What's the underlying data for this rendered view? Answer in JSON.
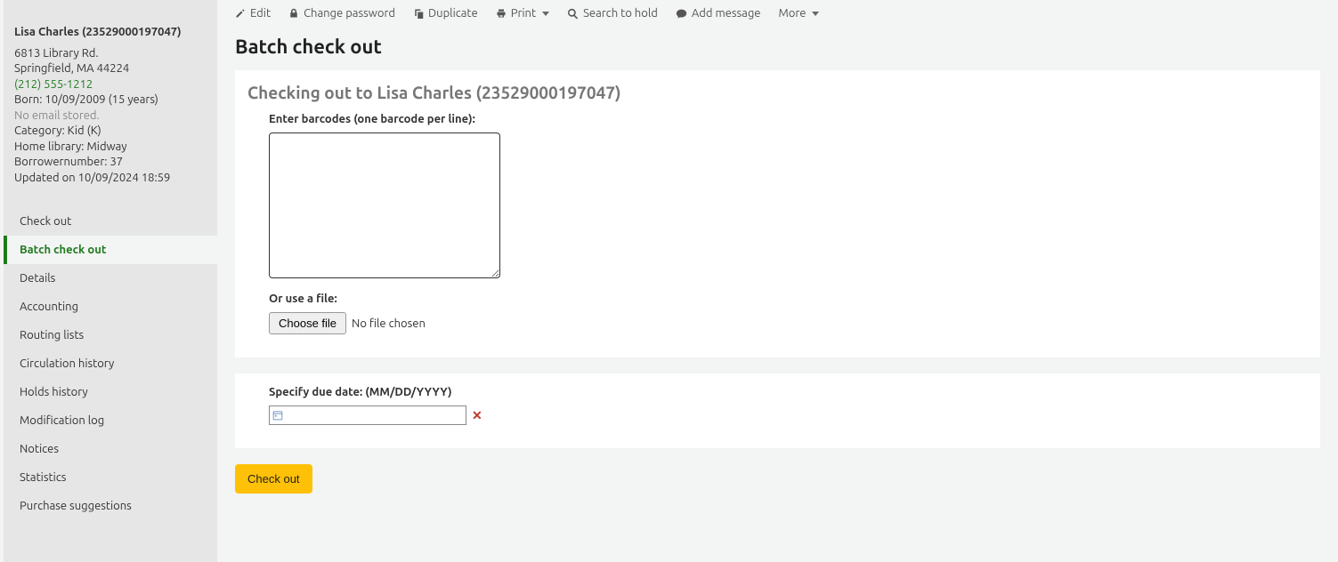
{
  "patron": {
    "name": "Lisa Charles (23529000197047)",
    "address1": "6813 Library Rd.",
    "address2": "Springfield, MA 44224",
    "phone": "(212) 555-1212",
    "born": "Born: 10/09/2009 (15 years)",
    "email": "No email stored.",
    "category": "Category: Kid (K)",
    "homeLibrary": "Home library: Midway",
    "borrowerNumber": "Borrowernumber: 37",
    "updated": "Updated on 10/09/2024 18:59"
  },
  "nav": {
    "checkout": "Check out",
    "batch": "Batch check out",
    "details": "Details",
    "accounting": "Accounting",
    "routing": "Routing lists",
    "circ": "Circulation history",
    "holds": "Holds history",
    "modlog": "Modification log",
    "notices": "Notices",
    "stats": "Statistics",
    "purchase": "Purchase suggestions"
  },
  "toolbar": {
    "edit": "Edit",
    "changePassword": "Change password",
    "duplicate": "Duplicate",
    "print": "Print",
    "searchToHold": "Search to hold",
    "addMessage": "Add message",
    "more": "More"
  },
  "page": {
    "title": "Batch check out",
    "checkingOutTo": "Checking out to Lisa Charles (23529000197047)",
    "barcodesLabel": "Enter barcodes (one barcode per line):",
    "barcodesValue": "",
    "orUseFile": "Or use a file:",
    "chooseFile": "Choose file",
    "noFile": "No file chosen",
    "dueDateLabel": "Specify due date: (MM/DD/YYYY)",
    "dueDateValue": "",
    "submit": "Check out"
  }
}
